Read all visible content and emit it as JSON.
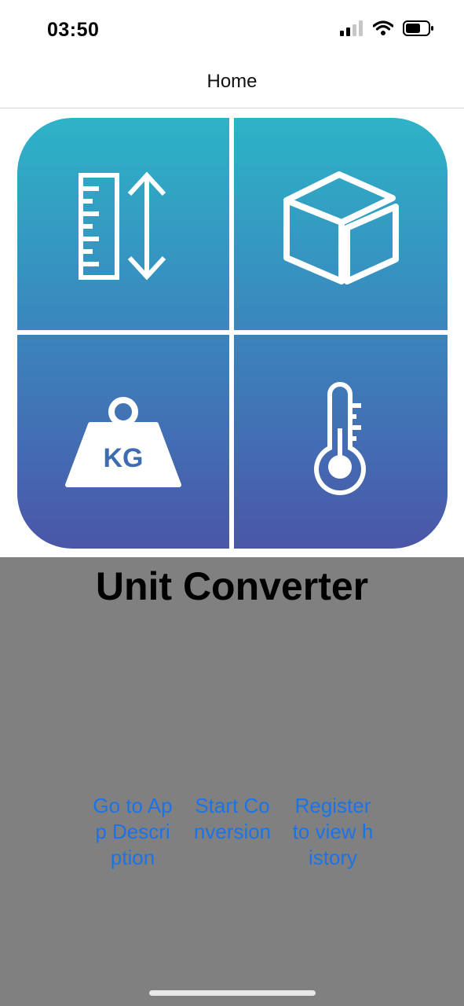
{
  "status_bar": {
    "time": "03:50",
    "icons": [
      "signal-icon",
      "wifi-icon",
      "battery-icon"
    ]
  },
  "nav": {
    "title": "Home"
  },
  "logo": {
    "name": "unit-converter-logo",
    "weight_label": "KG",
    "colors": {
      "top": "#2db3c7",
      "bottom": "#4b56a8",
      "stroke": "#ffffff"
    }
  },
  "main": {
    "title": "Unit Converter",
    "background": "#808080",
    "links": {
      "description": "Go to App Description",
      "start": "Start Conversion",
      "register": "Register to view history"
    },
    "link_color": "#1a73e8"
  }
}
